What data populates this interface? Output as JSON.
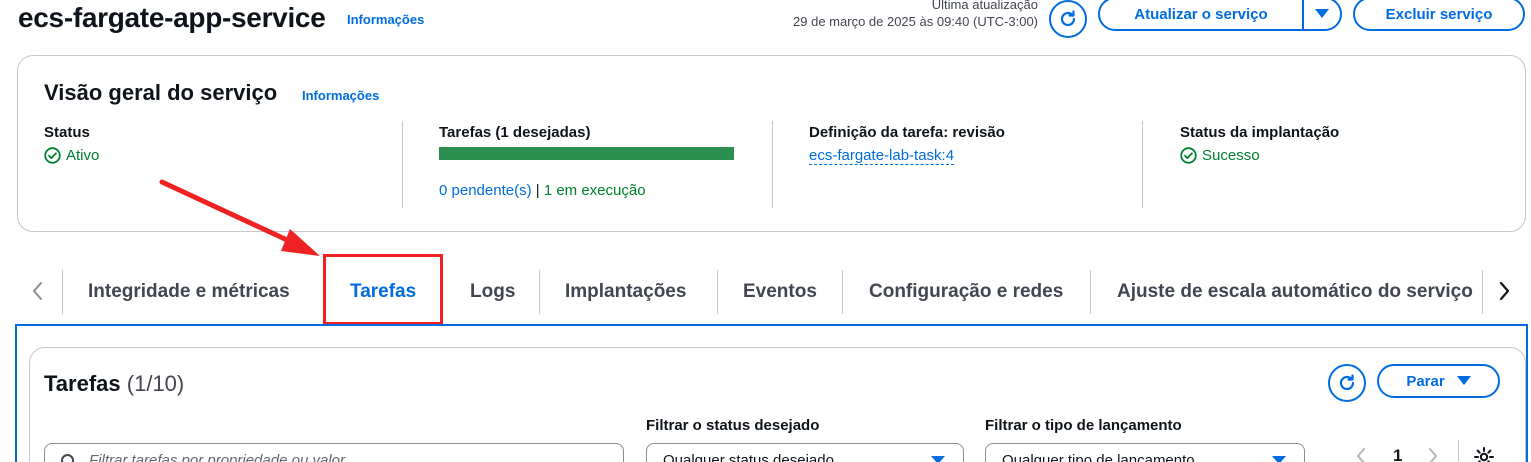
{
  "header": {
    "title": "ecs-fargate-app-service",
    "info_link": "Informações",
    "last_update_label": "Última atualização",
    "last_update_value": "29 de março de 2025 às 09:40 (UTC-3:00)",
    "update_button": "Atualizar o serviço",
    "delete_button": "Excluir serviço"
  },
  "overview": {
    "title": "Visão geral do serviço",
    "info_link": "Informações",
    "status_label": "Status",
    "status_value": "Ativo",
    "tasks_label": "Tarefas (1 desejadas)",
    "tasks_progress": 1.0,
    "pending": "0 pendente(s)",
    "separator": "|",
    "running": "1 em execução",
    "taskdef_label": "Definição da tarefa: revisão",
    "taskdef_value": "ecs-fargate-lab-task:4",
    "deploy_label": "Status da implantação",
    "deploy_value": "Sucesso"
  },
  "tabs": [
    {
      "label": "Integridade e métricas"
    },
    {
      "label": "Tarefas"
    },
    {
      "label": "Logs"
    },
    {
      "label": "Implantações"
    },
    {
      "label": "Eventos"
    },
    {
      "label": "Configuração e redes"
    },
    {
      "label": "Ajuste de escala automático do serviço"
    }
  ],
  "active_tab": "Tarefas",
  "tasks": {
    "title": "Tarefas",
    "count": "(1/10)",
    "stop_button": "Parar",
    "search_placeholder": "Filtrar tarefas por propriedade ou valor",
    "status_filter_label": "Filtrar o status desejado",
    "status_filter_value": "Qualquer status desejado",
    "launch_filter_label": "Filtrar o tipo de lançamento",
    "launch_filter_value": "Qualquer tipo de lançamento",
    "page_number": "1"
  },
  "colors": {
    "accent": "#006ce0",
    "success": "#00802f",
    "highlight": "#ee2222"
  }
}
